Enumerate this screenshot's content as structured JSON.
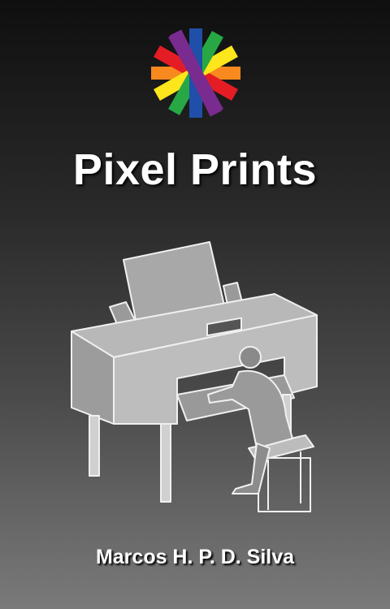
{
  "cover": {
    "title": "Pixel Prints",
    "author": "Marcos H. P. D. Silva"
  },
  "logo": {
    "icon": "rainbow-asterisk-logo-icon",
    "colors": [
      "#e41d25",
      "#f7891e",
      "#fde61b",
      "#27a844",
      "#1f4fa8",
      "#7a2b8f"
    ]
  },
  "illustration": {
    "icon": "person-using-large-printer-icon"
  }
}
